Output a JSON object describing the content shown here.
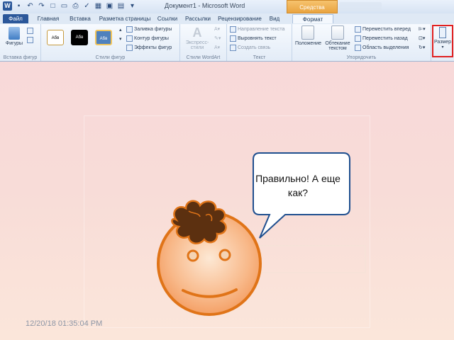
{
  "window": {
    "title": "Документ1 - Microsoft Word",
    "context_tab": "Средства рисования"
  },
  "tabs": {
    "file": "Файл",
    "home": "Главная",
    "insert": "Вставка",
    "layout": "Разметка страницы",
    "references": "Ссылки",
    "mailings": "Рассылки",
    "review": "Рецензирование",
    "view": "Вид",
    "format": "Формат"
  },
  "ribbon": {
    "insert_shapes": {
      "shapes_label": "Фигуры",
      "group_label": "Вставка фигур"
    },
    "shape_styles": {
      "style_sample": "Абв",
      "fill": "Заливка фигуры",
      "outline": "Контур фигуры",
      "effects": "Эффекты фигур",
      "group_label": "Стили фигур"
    },
    "wordart": {
      "express_label": "Экспресс-стили",
      "group_label": "Стили WordArt"
    },
    "text": {
      "direction": "Направление текста",
      "align": "Выровнять текст",
      "link": "Создать связь",
      "group_label": "Текст"
    },
    "arrange": {
      "position": "Положение",
      "wrap": "Обтекание текстом",
      "bring_forward": "Переместить вперед",
      "send_backward": "Переместить назад",
      "selection_pane": "Область выделения",
      "group_label": "Упорядочить"
    },
    "size": {
      "label": "Размер"
    }
  },
  "slide": {
    "bubble_text": "Правильно! А еще как?",
    "date": "12/20/18 01:35:04 PM"
  },
  "colors": {
    "face_outline": "#e07418",
    "hair": "#5c3010",
    "word_blue": "#2b579a",
    "context_orange": "#eaa544",
    "highlight_red": "#e02020"
  }
}
